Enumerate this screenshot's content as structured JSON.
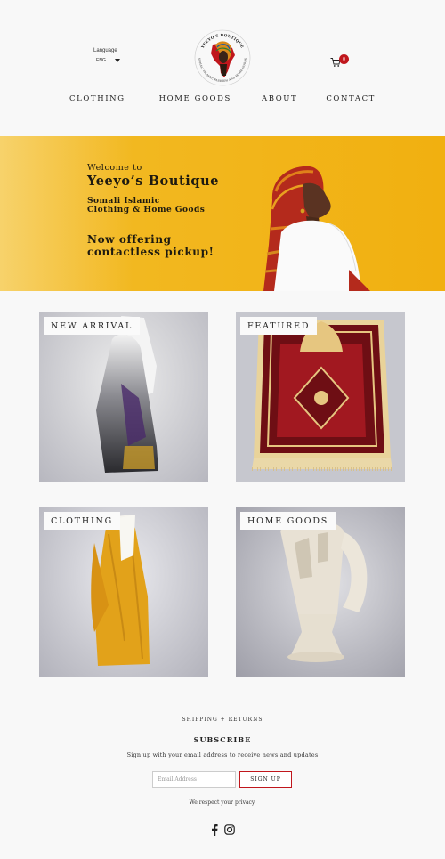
{
  "header": {
    "language_label": "Language",
    "language_value": "ENG",
    "logo_text_top": "YEEYO'S BOUTIQUE",
    "logo_text_bottom": "SOMALI ISLAMIC FASHION AND HOME GOODS",
    "cart_count": "0"
  },
  "nav": {
    "items": [
      "CLOTHING",
      "HOME GOODS",
      "ABOUT",
      "CONTACT"
    ]
  },
  "hero": {
    "welcome": "Welcome to",
    "title": "Yeeyo’s Boutique",
    "subtitle_line1": "Somali Islamic",
    "subtitle_line2": "Clothing & Home Goods",
    "offer_line1": "Now offering",
    "offer_line2": "contactless pickup!"
  },
  "tiles": [
    {
      "label": "NEW ARRIVAL"
    },
    {
      "label": "FEATURED"
    },
    {
      "label": "CLOTHING"
    },
    {
      "label": "HOME GOODS"
    }
  ],
  "footer": {
    "shipping_link": "SHIPPING + RETURNS",
    "subscribe_heading": "SUBSCRIBE",
    "subscribe_text": "Sign up with your email address to receive news and updates",
    "email_placeholder": "Email Address",
    "signup_label": "SIGN UP",
    "privacy_text": "We respect your privacy."
  },
  "colors": {
    "hero_yellow": "#f1b010",
    "accent_red": "#c0161c",
    "background": "#f8f8f8"
  },
  "icons": [
    "caret-down-icon",
    "cart-icon",
    "facebook-icon",
    "instagram-icon"
  ]
}
